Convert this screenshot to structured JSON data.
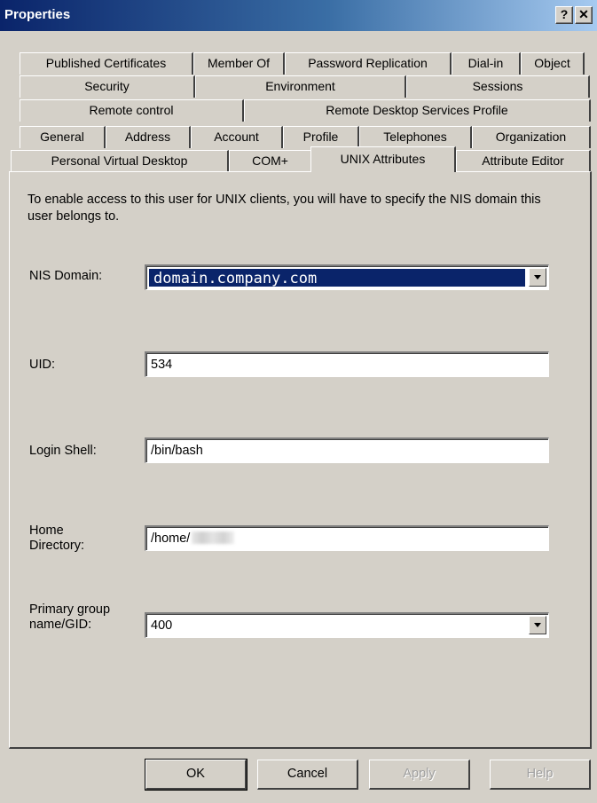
{
  "window": {
    "title": "Properties",
    "help_glyph": "?",
    "close_glyph": "✕"
  },
  "tabs": {
    "row1": [
      "Published Certificates",
      "Member Of",
      "Password Replication",
      "Dial-in",
      "Object"
    ],
    "row2": [
      "Security",
      "Environment",
      "Sessions"
    ],
    "row3": [
      "Remote control",
      "Remote Desktop Services Profile"
    ],
    "row4": [
      "General",
      "Address",
      "Account",
      "Profile",
      "Telephones",
      "Organization"
    ],
    "row5": [
      "Personal Virtual Desktop",
      "COM+",
      "UNIX Attributes",
      "Attribute Editor"
    ],
    "active": "UNIX Attributes"
  },
  "unix": {
    "intro": "To enable access to this user for UNIX clients, you will have to specify the NIS domain this user belongs to.",
    "nis_domain_label": "NIS Domain:",
    "nis_domain_value": "domain.company.com",
    "uid_label": "UID:",
    "uid_value": "534",
    "login_shell_label": "Login Shell:",
    "login_shell_value": "/bin/bash",
    "home_dir_label_line1": "Home",
    "home_dir_label_line2": "Directory:",
    "home_dir_value": "/home/",
    "gid_label_line1": "Primary group",
    "gid_label_line2": "name/GID:",
    "gid_value": "400"
  },
  "buttons": {
    "ok": "OK",
    "cancel": "Cancel",
    "apply": "Apply",
    "help": "Help"
  },
  "colors": {
    "title_start": "#0a246a",
    "title_end": "#a6caf0",
    "face": "#d4d0c8",
    "selection": "#0a246a"
  }
}
